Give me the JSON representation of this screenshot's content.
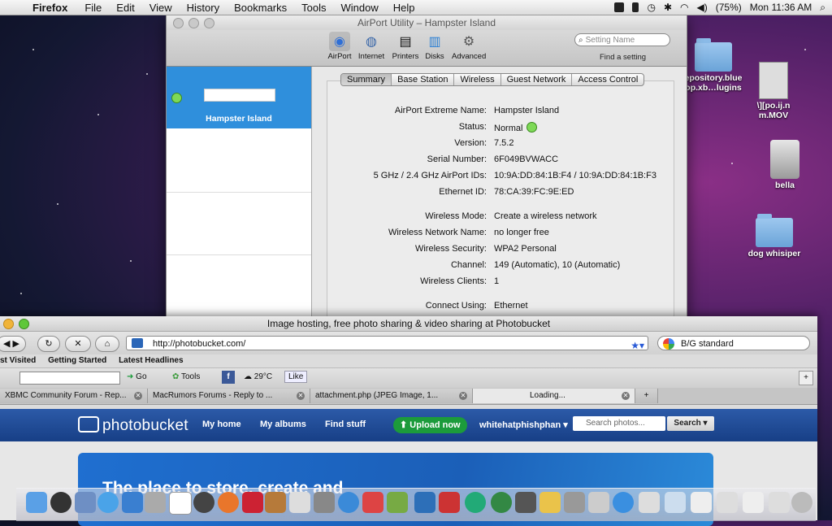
{
  "menubar": {
    "app": "Firefox",
    "items": [
      "File",
      "Edit",
      "View",
      "History",
      "Bookmarks",
      "Tools",
      "Window",
      "Help"
    ],
    "battery": "(75%)",
    "clock": "Mon 11:36 AM"
  },
  "airport": {
    "title": "AirPort Utility – Hampster Island",
    "toolbar": [
      "AirPort",
      "Internet",
      "Printers",
      "Disks",
      "Advanced"
    ],
    "search_placeholder": "Setting Name",
    "find_label": "Find a setting",
    "device_name": "Hampster Island",
    "tabs": [
      "Summary",
      "Base Station",
      "Wireless",
      "Guest Network",
      "Access Control"
    ],
    "summary": [
      {
        "k": "AirPort Extreme Name:",
        "v": "Hampster Island"
      },
      {
        "k": "Status:",
        "v": "Normal"
      },
      {
        "k": "Version:",
        "v": "7.5.2"
      },
      {
        "k": "Serial Number:",
        "v": "6F049BVWACC"
      },
      {
        "k": "5 GHz / 2.4 GHz AirPort IDs:",
        "v": "10:9A:DD:84:1B:F4 / 10:9A:DD:84:1B:F3"
      },
      {
        "k": "Ethernet ID:",
        "v": "78:CA:39:FC:9E:ED"
      },
      {
        "k": "Wireless Mode:",
        "v": "Create a wireless network"
      },
      {
        "k": "Wireless Network Name:",
        "v": "no longer free"
      },
      {
        "k": "Wireless Security:",
        "v": "WPA2 Personal"
      },
      {
        "k": "Channel:",
        "v": "149 (Automatic), 10 (Automatic)"
      },
      {
        "k": "Wireless Clients:",
        "v": "1"
      },
      {
        "k": "Connect Using:",
        "v": "Ethernet"
      }
    ]
  },
  "desktop": {
    "icons": [
      "epository.blue\nop.xb…lugins",
      "\\][po.ij.n\nm.MOV",
      "bella",
      "dog whisiper"
    ]
  },
  "firefox": {
    "title": "Image hosting, free photo sharing & video sharing at Photobucket",
    "url": "http://photobucket.com/",
    "search_value": "B/G standard",
    "bookmarks": [
      "st Visited",
      "Getting Started",
      "Latest Headlines"
    ],
    "toolbar2": {
      "go": "Go",
      "tools": "Tools",
      "temp": "29°C",
      "like": "Like"
    },
    "tabs": [
      {
        "label": "XBMC Community Forum - Rep...",
        "active": false
      },
      {
        "label": "MacRumors Forums - Reply to ...",
        "active": false
      },
      {
        "label": "attachment.php (JPEG Image, 1...",
        "active": false
      },
      {
        "label": "Loading...",
        "active": true
      }
    ],
    "photobucket": {
      "logo": "photobucket",
      "nav": [
        "My home",
        "My albums",
        "Find stuff"
      ],
      "upload": "Upload now",
      "user": "whitehatphishphan",
      "search_placeholder": "Search photos...",
      "search_button": "Search",
      "headline": "The place to store, create and"
    }
  }
}
